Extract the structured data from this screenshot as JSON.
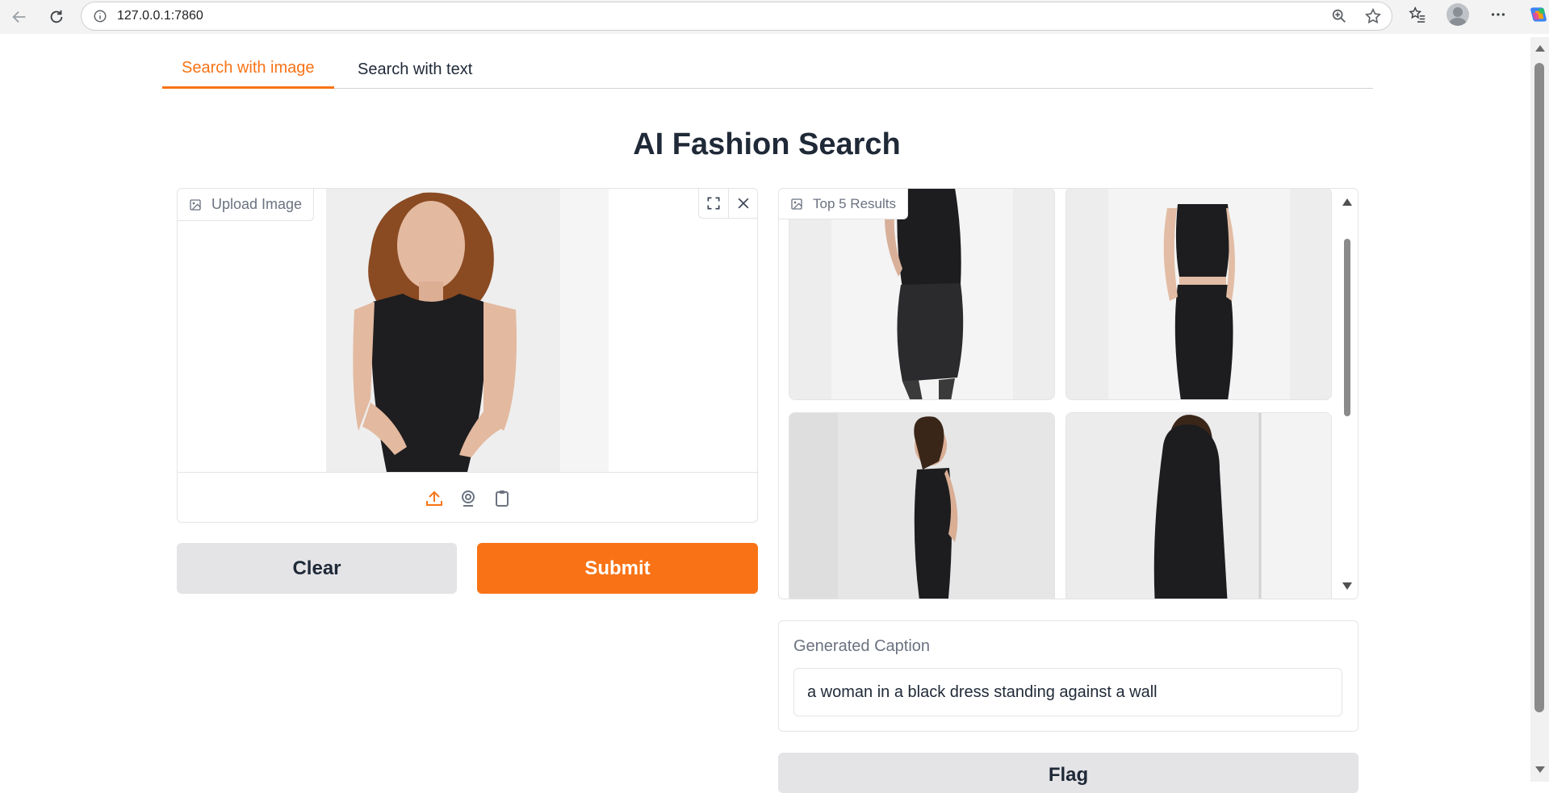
{
  "browser": {
    "url": "127.0.0.1:7860",
    "icons": [
      "back-icon",
      "reload-icon",
      "info-icon",
      "zoom-icon",
      "favorite-star-icon",
      "favorites-list-icon",
      "profile-avatar",
      "more-icon",
      "copilot-icon"
    ]
  },
  "tabs": [
    {
      "label": "Search with image",
      "active": true
    },
    {
      "label": "Search with text",
      "active": false
    }
  ],
  "page_title": "AI Fashion Search",
  "upload": {
    "label": "Upload Image",
    "source_icons": [
      "upload-icon",
      "webcam-icon",
      "clipboard-icon"
    ],
    "tool_icons": [
      "fullscreen-icon",
      "close-icon"
    ]
  },
  "buttons": {
    "clear": "Clear",
    "submit": "Submit",
    "flag": "Flag"
  },
  "results": {
    "label": "Top 5 Results",
    "items_visible": 4
  },
  "caption": {
    "label": "Generated Caption",
    "value": "a woman in a black dress standing against a wall"
  },
  "colors": {
    "accent": "#f97316",
    "secondary_button": "#e4e4e7",
    "text": "#1f2937",
    "muted": "#6b7280"
  }
}
